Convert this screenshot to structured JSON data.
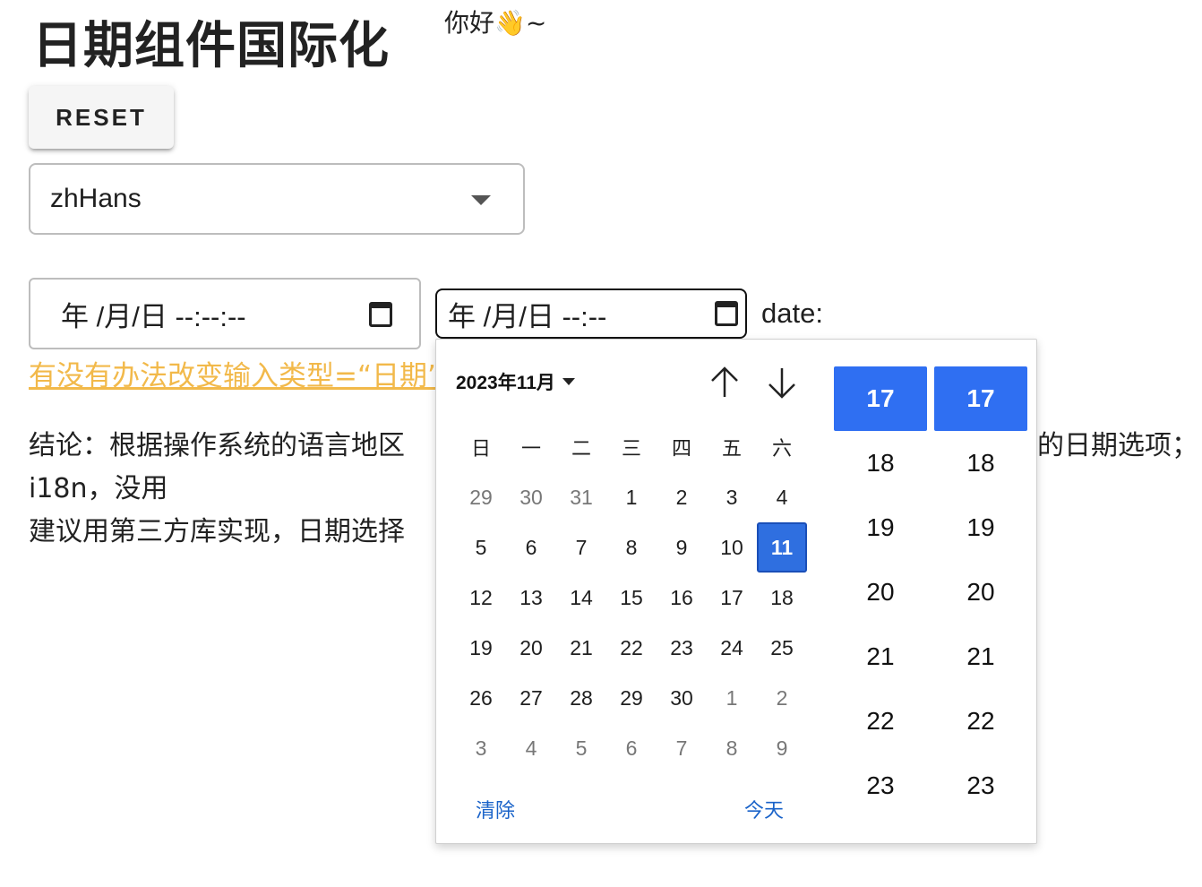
{
  "page": {
    "title": "日期组件国际化",
    "greeting": "你好👋~"
  },
  "reset_button": {
    "label": "RESET"
  },
  "locale_select": {
    "value": "zhHans"
  },
  "datetime_input": {
    "value": "年 /月/日 --:--:--"
  },
  "datetime_input_short": {
    "value": "年 /月/日 --:--"
  },
  "date_label": "date:",
  "link": {
    "text": "有没有办法改变输入类型=“日期”"
  },
  "conclusion": {
    "line1": "结论：根据操作系统的语言地区",
    "line1_end": "的日期选项；",
    "line2": "i18n，没用",
    "line3": "建议用第三方库实现，日期选择"
  },
  "picker": {
    "month_label": "2023年11月",
    "weekdays": [
      "日",
      "一",
      "二",
      "三",
      "四",
      "五",
      "六"
    ],
    "weeks": [
      [
        {
          "d": "29",
          "other": true
        },
        {
          "d": "30",
          "other": true
        },
        {
          "d": "31",
          "other": true
        },
        {
          "d": "1"
        },
        {
          "d": "2"
        },
        {
          "d": "3"
        },
        {
          "d": "4"
        }
      ],
      [
        {
          "d": "5"
        },
        {
          "d": "6"
        },
        {
          "d": "7"
        },
        {
          "d": "8"
        },
        {
          "d": "9"
        },
        {
          "d": "10"
        },
        {
          "d": "11",
          "selected": true
        }
      ],
      [
        {
          "d": "12"
        },
        {
          "d": "13"
        },
        {
          "d": "14"
        },
        {
          "d": "15"
        },
        {
          "d": "16"
        },
        {
          "d": "17"
        },
        {
          "d": "18"
        }
      ],
      [
        {
          "d": "19"
        },
        {
          "d": "20"
        },
        {
          "d": "21"
        },
        {
          "d": "22"
        },
        {
          "d": "23"
        },
        {
          "d": "24"
        },
        {
          "d": "25"
        }
      ],
      [
        {
          "d": "26"
        },
        {
          "d": "27"
        },
        {
          "d": "28"
        },
        {
          "d": "29"
        },
        {
          "d": "30"
        },
        {
          "d": "1",
          "other": true
        },
        {
          "d": "2",
          "other": true
        }
      ],
      [
        {
          "d": "3",
          "other": true
        },
        {
          "d": "4",
          "other": true
        },
        {
          "d": "5",
          "other": true
        },
        {
          "d": "6",
          "other": true
        },
        {
          "d": "7",
          "other": true
        },
        {
          "d": "8",
          "other": true
        },
        {
          "d": "9",
          "other": true
        }
      ]
    ],
    "clear_label": "清除",
    "today_label": "今天",
    "hours": [
      "17",
      "18",
      "19",
      "20",
      "21",
      "22",
      "23"
    ],
    "minutes": [
      "17",
      "18",
      "19",
      "20",
      "21",
      "22",
      "23"
    ],
    "selected_hour": "17",
    "selected_minute": "17",
    "accent_color": "#2f6ff2"
  },
  "icons": {
    "select_arrow": "chevron-down-icon",
    "calendar": "calendar-icon",
    "nav_up": "arrow-up-icon",
    "nav_down": "arrow-down-icon"
  }
}
